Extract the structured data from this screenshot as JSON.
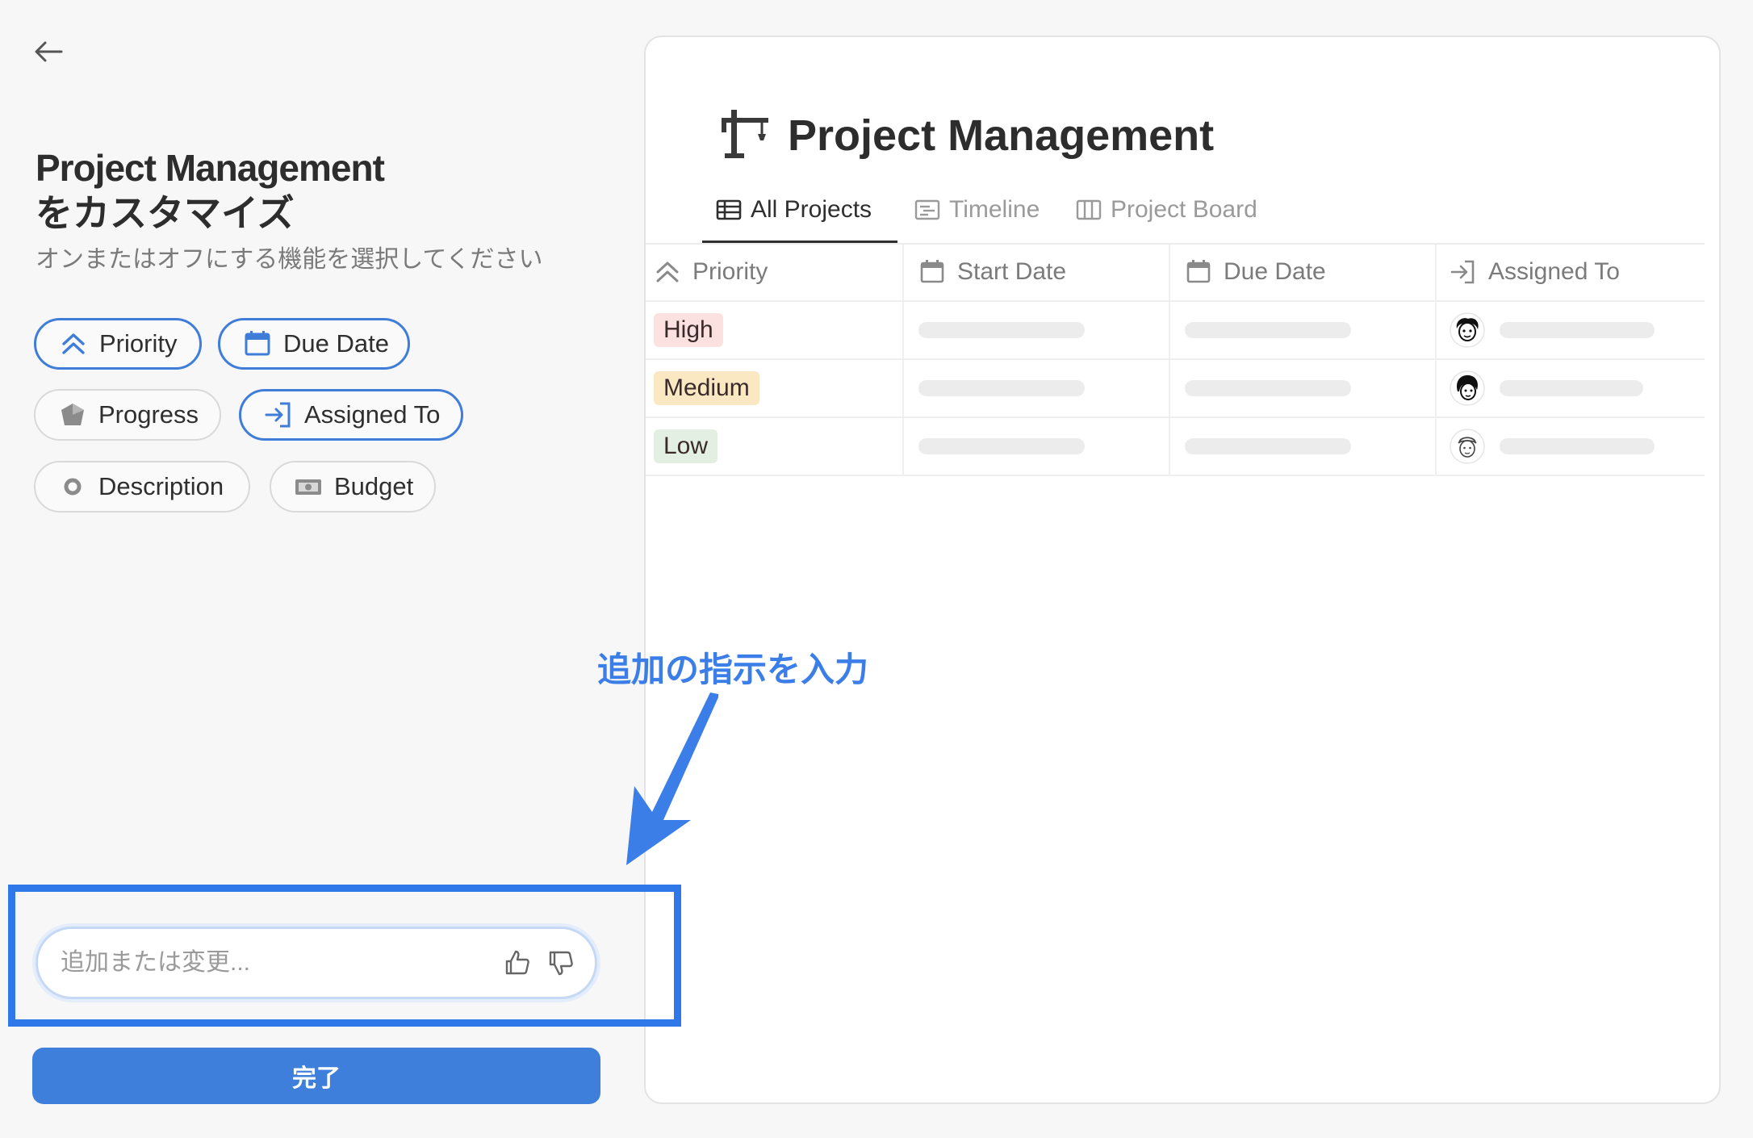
{
  "sidebar": {
    "title_line1": "Project Management",
    "title_line2": "をカスタマイズ",
    "subtitle": "オンまたはオフにする機能を選択してください",
    "chips": [
      {
        "label": "Priority",
        "icon": "double-chevron-up-icon",
        "enabled": true
      },
      {
        "label": "Due Date",
        "icon": "calendar-icon",
        "enabled": true
      },
      {
        "label": "Progress",
        "icon": "pentagon-icon",
        "enabled": false
      },
      {
        "label": "Assigned To",
        "icon": "sign-in-icon",
        "enabled": true
      },
      {
        "label": "Description",
        "icon": "circle-icon",
        "enabled": false
      },
      {
        "label": "Budget",
        "icon": "banknote-icon",
        "enabled": false
      }
    ],
    "prompt": {
      "placeholder": "追加または変更...",
      "value": ""
    },
    "done_label": "完了"
  },
  "annotation": {
    "text": "追加の指示を入力",
    "color": "#3b7ee8"
  },
  "preview": {
    "title": "Project Management",
    "icon": "crane-icon",
    "tabs": [
      {
        "label": "All Projects",
        "icon": "table-icon",
        "active": true
      },
      {
        "label": "Timeline",
        "icon": "timeline-icon",
        "active": false
      },
      {
        "label": "Project Board",
        "icon": "board-icon",
        "active": false
      }
    ],
    "columns": [
      "Priority",
      "Start Date",
      "Due Date",
      "Assigned To"
    ],
    "rows": [
      {
        "priority": "High"
      },
      {
        "priority": "Medium"
      },
      {
        "priority": "Low"
      }
    ]
  },
  "colors": {
    "accent": "#3f7fdc",
    "high": "#fbe1e0",
    "medium": "#f9e8c1",
    "low": "#e2efe2"
  }
}
